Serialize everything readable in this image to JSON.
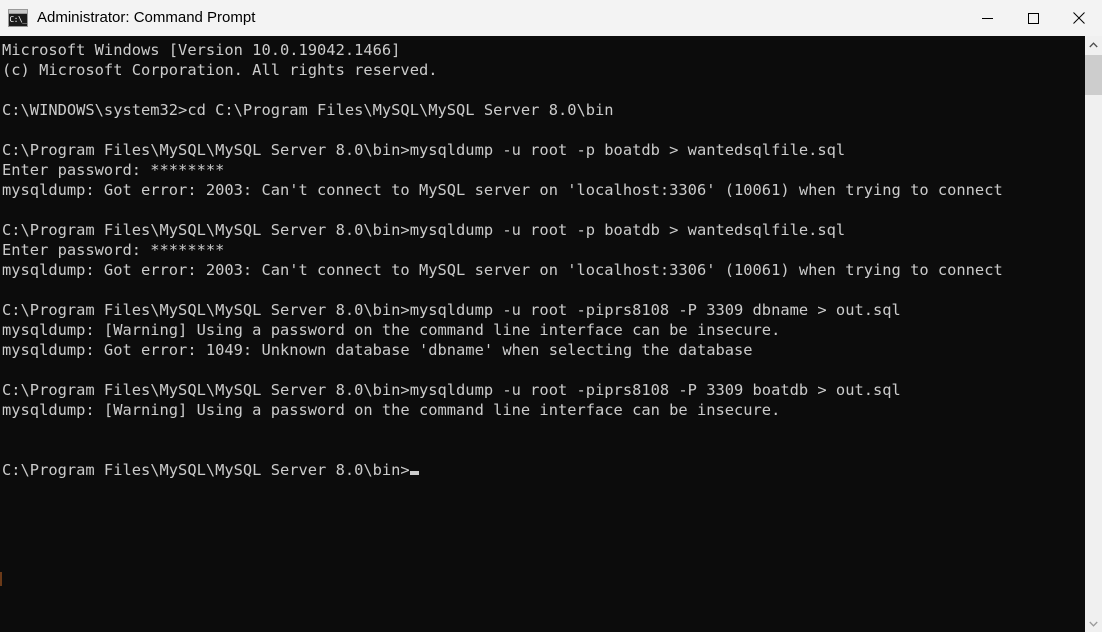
{
  "window": {
    "title": "Administrator: Command Prompt",
    "icon_name": "command-prompt-icon",
    "icon_glyph": "C:\\_",
    "background_color": "#0c0c0c",
    "titlebar_color": "#f3f3f3",
    "text_color": "#cccccc"
  },
  "window_controls": {
    "minimize_label": "Minimize",
    "maximize_label": "Maximize",
    "close_label": "Close"
  },
  "console": {
    "lines": [
      "Microsoft Windows [Version 10.0.19042.1466]",
      "(c) Microsoft Corporation. All rights reserved.",
      "",
      "C:\\WINDOWS\\system32>cd C:\\Program Files\\MySQL\\MySQL Server 8.0\\bin",
      "",
      "C:\\Program Files\\MySQL\\MySQL Server 8.0\\bin>mysqldump -u root -p boatdb > wantedsqlfile.sql",
      "Enter password: ********",
      "mysqldump: Got error: 2003: Can't connect to MySQL server on 'localhost:3306' (10061) when trying to connect",
      "",
      "C:\\Program Files\\MySQL\\MySQL Server 8.0\\bin>mysqldump -u root -p boatdb > wantedsqlfile.sql",
      "Enter password: ********",
      "mysqldump: Got error: 2003: Can't connect to MySQL server on 'localhost:3306' (10061) when trying to connect",
      "",
      "C:\\Program Files\\MySQL\\MySQL Server 8.0\\bin>mysqldump -u root -piprs8108 -P 3309 dbname > out.sql",
      "mysqldump: [Warning] Using a password on the command line interface can be insecure.",
      "mysqldump: Got error: 1049: Unknown database 'dbname' when selecting the database",
      "",
      "C:\\Program Files\\MySQL\\MySQL Server 8.0\\bin>mysqldump -u root -piprs8108 -P 3309 boatdb > out.sql",
      "mysqldump: [Warning] Using a password on the command line interface can be insecure.",
      "",
      ""
    ],
    "prompt": "C:\\Program Files\\MySQL\\MySQL Server 8.0\\bin>"
  },
  "scrollbar": {
    "up_arrow_name": "scroll-up-arrow",
    "down_arrow_name": "scroll-down-arrow",
    "thumb_name": "scrollbar-thumb"
  }
}
